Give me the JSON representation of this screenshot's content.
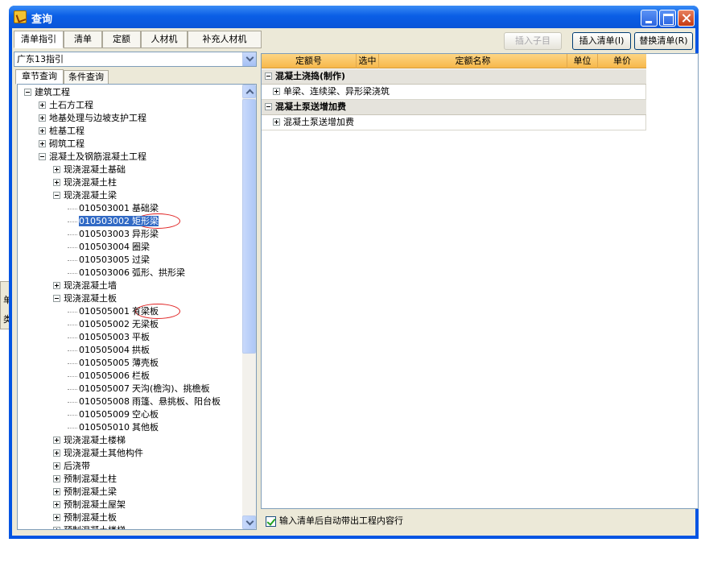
{
  "window": {
    "title": "查询"
  },
  "top_tabs": [
    "清单指引",
    "清单",
    "定额",
    "人材机",
    "补充人材机"
  ],
  "buttons": {
    "insert_child": "插入子目",
    "insert_list": "插入清单(I)",
    "replace_list": "替换清单(R)"
  },
  "combo": {
    "value": "广东13指引"
  },
  "sub_tabs": [
    "章节查询",
    "条件查询"
  ],
  "tree": [
    {
      "type": "node",
      "indent": 0,
      "expanded": true,
      "label": "建筑工程"
    },
    {
      "type": "node",
      "indent": 1,
      "expanded": false,
      "label": "土石方工程"
    },
    {
      "type": "node",
      "indent": 1,
      "expanded": false,
      "label": "地基处理与边坡支护工程"
    },
    {
      "type": "node",
      "indent": 1,
      "expanded": false,
      "label": "桩基工程"
    },
    {
      "type": "node",
      "indent": 1,
      "expanded": false,
      "label": "砌筑工程"
    },
    {
      "type": "node",
      "indent": 1,
      "expanded": true,
      "label": "混凝土及钢筋混凝土工程"
    },
    {
      "type": "node",
      "indent": 2,
      "expanded": false,
      "label": "现浇混凝土基础"
    },
    {
      "type": "node",
      "indent": 2,
      "expanded": false,
      "label": "现浇混凝土柱"
    },
    {
      "type": "node",
      "indent": 2,
      "expanded": true,
      "label": "现浇混凝土梁"
    },
    {
      "type": "leaf",
      "code": "010503001",
      "label": "基础梁"
    },
    {
      "type": "leaf",
      "code": "010503002",
      "label": "矩形梁",
      "selected": true,
      "circled": true
    },
    {
      "type": "leaf",
      "code": "010503003",
      "label": "异形梁"
    },
    {
      "type": "leaf",
      "code": "010503004",
      "label": "圈梁"
    },
    {
      "type": "leaf",
      "code": "010503005",
      "label": "过梁"
    },
    {
      "type": "leaf",
      "code": "010503006",
      "label": "弧形、拱形梁"
    },
    {
      "type": "node",
      "indent": 2,
      "expanded": false,
      "label": "现浇混凝土墙"
    },
    {
      "type": "node",
      "indent": 2,
      "expanded": true,
      "label": "现浇混凝土板"
    },
    {
      "type": "leaf",
      "code": "010505001",
      "label": "有梁板",
      "circled": true
    },
    {
      "type": "leaf",
      "code": "010505002",
      "label": "无梁板"
    },
    {
      "type": "leaf",
      "code": "010505003",
      "label": "平板"
    },
    {
      "type": "leaf",
      "code": "010505004",
      "label": "拱板"
    },
    {
      "type": "leaf",
      "code": "010505005",
      "label": "薄壳板"
    },
    {
      "type": "leaf",
      "code": "010505006",
      "label": "栏板"
    },
    {
      "type": "leaf",
      "code": "010505007",
      "label": "天沟(檐沟)、挑檐板"
    },
    {
      "type": "leaf",
      "code": "010505008",
      "label": "雨篷、悬挑板、阳台板"
    },
    {
      "type": "leaf",
      "code": "010505009",
      "label": "空心板"
    },
    {
      "type": "leaf",
      "code": "010505010",
      "label": "其他板"
    },
    {
      "type": "node",
      "indent": 2,
      "expanded": false,
      "label": "现浇混凝土楼梯"
    },
    {
      "type": "node",
      "indent": 2,
      "expanded": false,
      "label": "现浇混凝土其他构件"
    },
    {
      "type": "node",
      "indent": 2,
      "expanded": false,
      "label": "后浇带"
    },
    {
      "type": "node",
      "indent": 2,
      "expanded": false,
      "label": "预制混凝土柱"
    },
    {
      "type": "node",
      "indent": 2,
      "expanded": false,
      "label": "预制混凝土梁"
    },
    {
      "type": "node",
      "indent": 2,
      "expanded": false,
      "label": "预制混凝土屋架"
    },
    {
      "type": "node",
      "indent": 2,
      "expanded": false,
      "label": "预制混凝土板"
    },
    {
      "type": "node",
      "indent": 2,
      "expanded": false,
      "label": "预制混凝土楼梯"
    }
  ],
  "grid": {
    "columns": [
      "定额号",
      "选中",
      "定额名称",
      "单位",
      "单价"
    ],
    "groups": [
      {
        "title": "混凝土浇捣(制作)",
        "items": [
          "单梁、连续梁、异形梁浇筑"
        ]
      },
      {
        "title": "混凝土泵送增加费",
        "items": [
          "混凝土泵送增加费"
        ]
      }
    ]
  },
  "auto_checkbox": {
    "label": "输入清单后自动带出工程内容行",
    "checked": true
  },
  "background_window": {
    "chars": [
      "单",
      "类"
    ]
  },
  "colors": {
    "title_bar": "#0a5ee6",
    "grid_header": "#f7b84b",
    "selection": "#316ac5",
    "annotation": "#e02020"
  }
}
